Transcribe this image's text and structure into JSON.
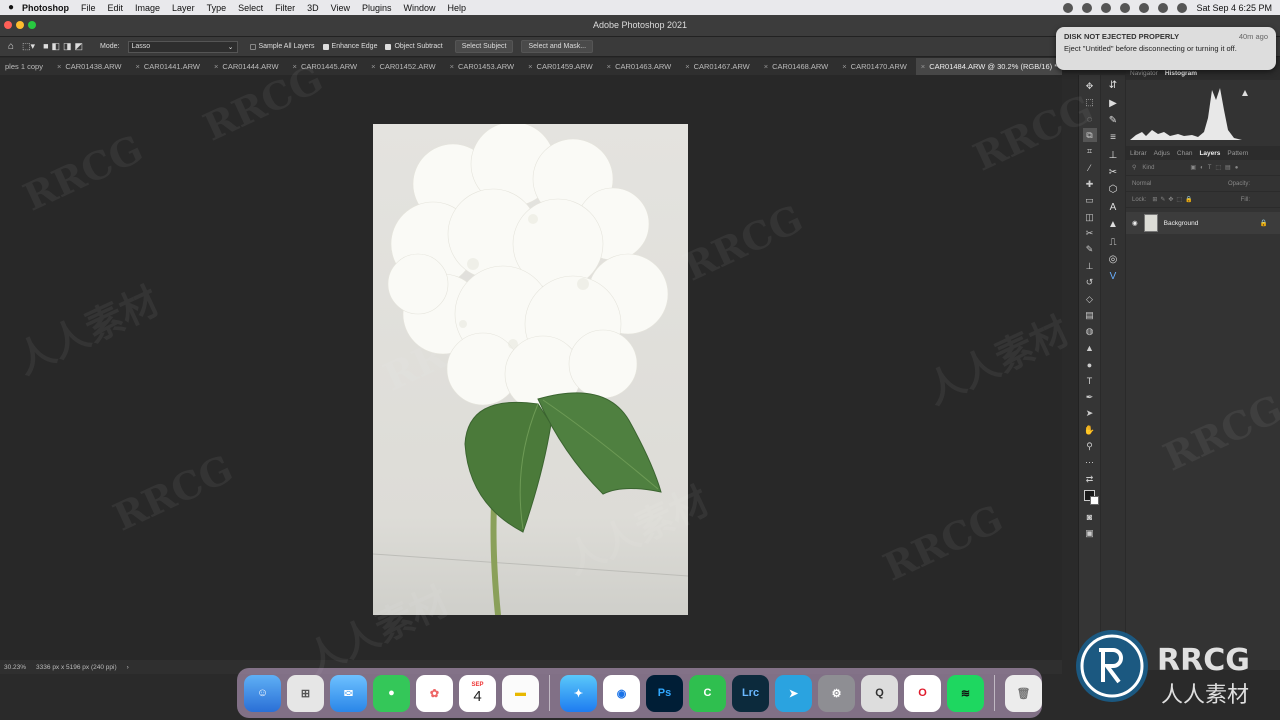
{
  "menubar": {
    "app_name": "Photoshop",
    "items": [
      "File",
      "Edit",
      "Image",
      "Layer",
      "Type",
      "Select",
      "Filter",
      "3D",
      "View",
      "Plugins",
      "Window",
      "Help"
    ],
    "clock": "Sat Sep 4  6:25 PM"
  },
  "titlebar": {
    "title": "Adobe Photoshop 2021"
  },
  "options": {
    "mode_label": "Mode:",
    "mode_value": "Lasso",
    "sample_all_layers": "Sample All Layers",
    "enhance_edge": "Enhance Edge",
    "object_subtract": "Object Subtract",
    "select_subject": "Select Subject",
    "select_and_mask": "Select and Mask..."
  },
  "tabs": [
    "ples 1 copy",
    "CAR01438.ARW",
    "CAR01441.ARW",
    "CAR01444.ARW",
    "CAR01445.ARW",
    "CAR01452.ARW",
    "CAR01453.ARW",
    "CAR01459.ARW",
    "CAR01463.ARW",
    "CAR01467.ARW",
    "CAR01468.ARW",
    "CAR01470.ARW"
  ],
  "active_tab": "CAR01484.ARW @ 30.2% (RGB/16) *",
  "status": {
    "zoom": "30.23%",
    "doc_info": "3336 px x 5196 px (240 ppi)",
    "arrow": "›"
  },
  "notification": {
    "title": "DISK NOT EJECTED PROPERLY",
    "time": "40m ago",
    "body": "Eject \"Untitled\" before disconnecting or turning it off."
  },
  "panels": {
    "top_tabs": [
      "Navigator",
      "Histogram"
    ],
    "layer_tabs": [
      "Librar",
      "Adjus",
      "Chan",
      "Layers",
      "Pattern"
    ],
    "kind_placeholder": "Kind",
    "blend": "Normal",
    "opacity": "Opacity:",
    "lock": "Lock:",
    "fill": "Fill:",
    "layer_name": "Background"
  },
  "dock": {
    "calendar_month": "SEP",
    "calendar_day": "4",
    "ps_label": "Ps",
    "lrc_label": "Lrc"
  },
  "watermark": {
    "text_latin": "RRCG",
    "text_cjk": "人人素材"
  },
  "colors": {
    "accent": "#2b7de9",
    "canvas": "#282828",
    "panel": "#333333"
  }
}
